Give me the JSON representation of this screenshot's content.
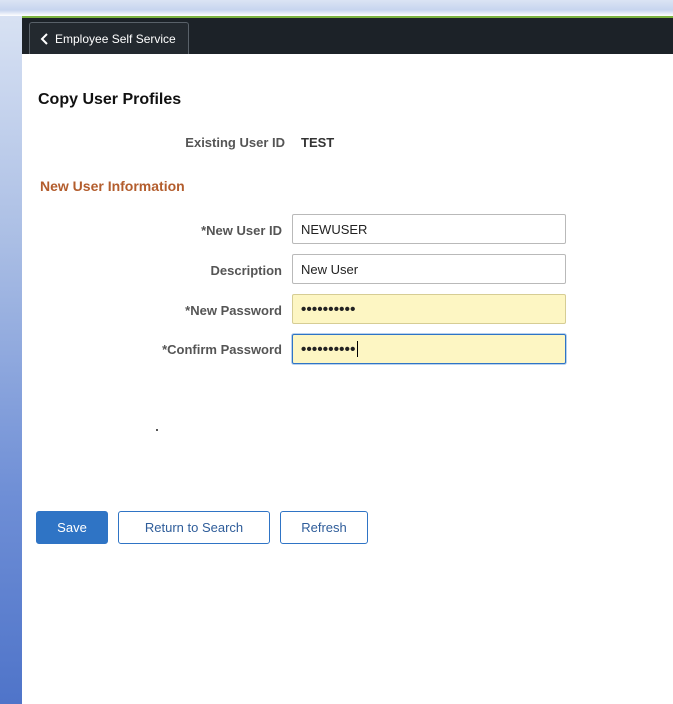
{
  "header": {
    "back_label": "Employee Self Service"
  },
  "page": {
    "title": "Copy User Profiles"
  },
  "existing": {
    "label": "Existing User ID",
    "value": "TEST"
  },
  "section": {
    "title": "New User Information"
  },
  "form": {
    "new_user_id": {
      "label": "*New User ID",
      "value": "NEWUSER"
    },
    "description": {
      "label": "Description",
      "value": "New User"
    },
    "new_password": {
      "label": "*New Password",
      "value": "••••••••••"
    },
    "confirm_password": {
      "label": "*Confirm Password",
      "value": "••••••••••"
    }
  },
  "buttons": {
    "save": "Save",
    "return_to_search": "Return to Search",
    "refresh": "Refresh"
  },
  "colors": {
    "primary": "#2f74c5",
    "section_title": "#b35d2d",
    "password_bg": "#fdf6c3",
    "header_bg": "#1c2228",
    "header_accent": "#7cb342"
  }
}
